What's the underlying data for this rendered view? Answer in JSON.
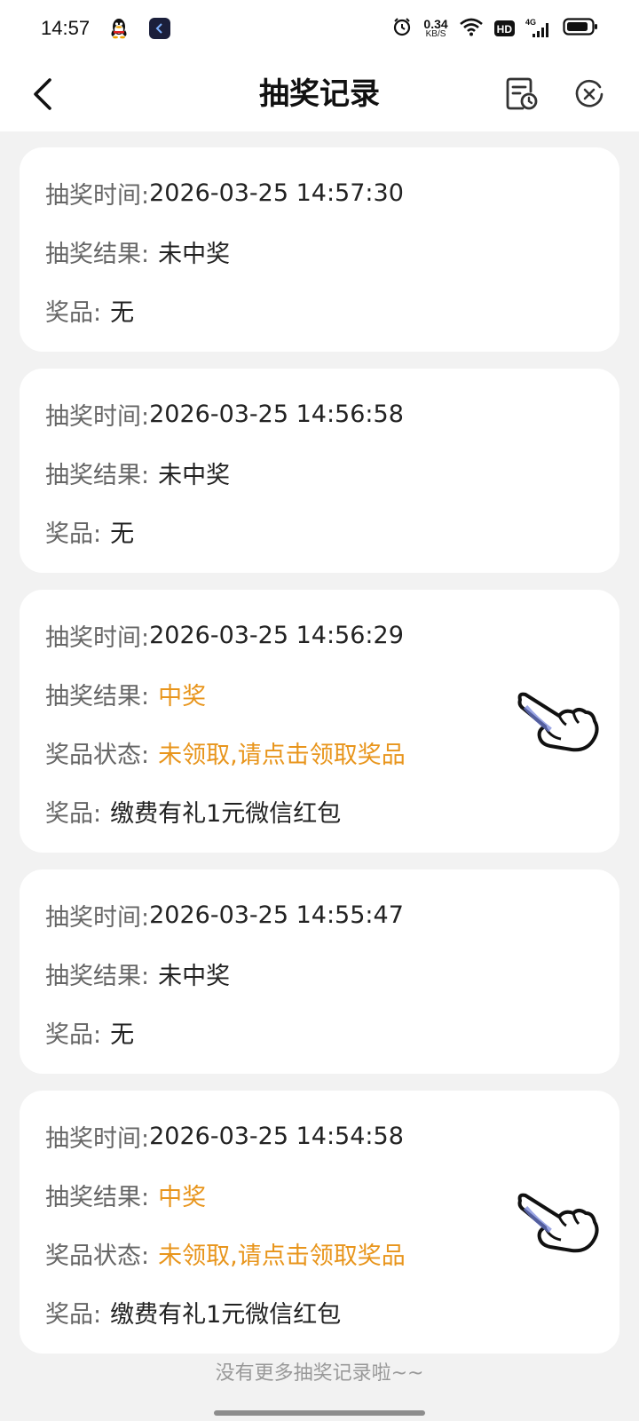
{
  "status_bar": {
    "time": "14:57",
    "net_speed_value": "0.34",
    "net_speed_unit": "KB/S",
    "hd_label": "HD",
    "network_label": "4G",
    "icons": [
      "qq-icon",
      "app-icon",
      "alarm-icon",
      "wifi-icon",
      "hd-icon",
      "signal-icon",
      "battery-icon"
    ]
  },
  "nav": {
    "title": "抽奖记录"
  },
  "records": [
    {
      "time_label": "抽奖时间:",
      "time": "2026-03-25 14:57:30",
      "result_label": "抽奖结果:",
      "result": "未中奖",
      "prize_label": "奖品:",
      "prize": "无"
    },
    {
      "time_label": "抽奖时间:",
      "time": "2026-03-25 14:56:58",
      "result_label": "抽奖结果:",
      "result": "未中奖",
      "prize_label": "奖品:",
      "prize": "无"
    },
    {
      "time_label": "抽奖时间:",
      "time": "2026-03-25 14:56:29",
      "result_label": "抽奖结果:",
      "result": "中奖",
      "status_label": "奖品状态:",
      "status": "未领取,请点击领取奖品",
      "prize_label": "奖品:",
      "prize": "缴费有礼1元微信红包"
    },
    {
      "time_label": "抽奖时间:",
      "time": "2026-03-25 14:55:47",
      "result_label": "抽奖结果:",
      "result": "未中奖",
      "prize_label": "奖品:",
      "prize": "无"
    },
    {
      "time_label": "抽奖时间:",
      "time": "2026-03-25 14:54:58",
      "result_label": "抽奖结果:",
      "result": "中奖",
      "status_label": "奖品状态:",
      "status": "未领取,请点击领取奖品",
      "prize_label": "奖品:",
      "prize": "缴费有礼1元微信红包"
    }
  ],
  "footer_note": "没有更多抽奖记录啦~~",
  "colors": {
    "win_accent": "#e8951c",
    "background": "#f2f2f2",
    "card": "#ffffff",
    "label": "#666666"
  }
}
